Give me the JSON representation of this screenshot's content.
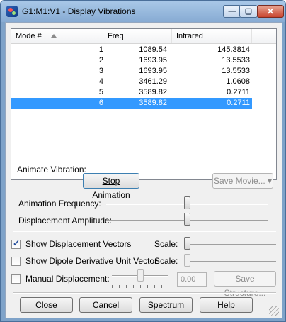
{
  "window": {
    "title": "G1:M1:V1 - Display Vibrations"
  },
  "table": {
    "columns": [
      "Mode #",
      "Freq",
      "Infrared"
    ],
    "rows": [
      {
        "mode": "1",
        "freq": "1089.54",
        "ir": "145.3814"
      },
      {
        "mode": "2",
        "freq": "1693.95",
        "ir": "13.5533"
      },
      {
        "mode": "3",
        "freq": "1693.95",
        "ir": "13.5533"
      },
      {
        "mode": "4",
        "freq": "3461.29",
        "ir": "1.0608"
      },
      {
        "mode": "5",
        "freq": "3589.82",
        "ir": "0.2711"
      },
      {
        "mode": "6",
        "freq": "3589.82",
        "ir": "0.2711"
      }
    ],
    "selected_mode": "6"
  },
  "animate": {
    "section_label": "Animate Vibration:",
    "stop_button": "Stop Animation",
    "save_movie_button": "Save Movie...",
    "frequency_label": "Animation Frequency:",
    "frequency_level": 0.5,
    "amplitude_label": "Displacement Amplitude:",
    "amplitude_level": 0.5
  },
  "options": {
    "show_vectors_label": "Show Displacement Vectors",
    "show_vectors_checked": true,
    "show_vectors_scale_label": "Scale:",
    "show_vectors_scale_level": 0.0,
    "show_dipole_label": "Show Dipole Derivative Unit Vector",
    "show_dipole_checked": false,
    "show_dipole_scale_label": "Scale:",
    "show_dipole_scale_level": 0.0,
    "manual_label": "Manual Displacement:",
    "manual_checked": false,
    "manual_value": "0.00",
    "manual_level": 0.5,
    "save_structure_button": "Save Structure..."
  },
  "footer": {
    "close": "Close",
    "cancel": "Cancel",
    "spectrum": "Spectrum",
    "help": "Help"
  }
}
